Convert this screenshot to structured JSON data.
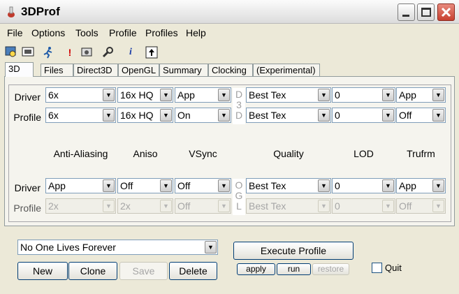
{
  "window": {
    "title": "3DProf"
  },
  "menu": [
    "File",
    "Options",
    "Tools",
    "Profile",
    "Profiles",
    "Help"
  ],
  "toolbar_icons": [
    "image-search-icon",
    "display-icon",
    "runner-icon",
    "exclamation-icon",
    "gear-icon",
    "wrench-icon",
    "info-icon",
    "upload-icon"
  ],
  "tabs": [
    "3D",
    "Files",
    "Direct3D",
    "OpenGL",
    "Summary",
    "Clocking",
    "(Experimental)"
  ],
  "d3d": {
    "vertical_letters": [
      "D",
      "3",
      "D"
    ],
    "driver_label": "Driver",
    "profile_label": "Profile",
    "driver": {
      "aa": "6x",
      "aniso": "16x HQ",
      "vsync": "App",
      "quality": "Best Tex",
      "lod": "0",
      "trufrm": "App"
    },
    "profile": {
      "aa": "6x",
      "aniso": "16x HQ",
      "vsync": "On",
      "quality": "Best Tex",
      "lod": "0",
      "trufrm": "Off"
    }
  },
  "columns": {
    "aa": "Anti-Aliasing",
    "aniso": "Aniso",
    "vsync": "VSync",
    "quality": "Quality",
    "lod": "LOD",
    "trufrm": "Trufrm"
  },
  "ogl": {
    "vertical_letters": [
      "O",
      "G",
      "L"
    ],
    "driver_label": "Driver",
    "profile_label": "Profile",
    "driver": {
      "aa": "App",
      "aniso": "Off",
      "vsync": "Off",
      "quality": "Best Tex",
      "lod": "0",
      "trufrm": "App"
    },
    "profile": {
      "aa": "2x",
      "aniso": "2x",
      "vsync": "Off",
      "quality": "Best Tex",
      "lod": "0",
      "trufrm": "Off"
    }
  },
  "profile_select": "No One Lives Forever",
  "buttons": {
    "new": "New",
    "clone": "Clone",
    "save": "Save",
    "delete": "Delete",
    "execute": "Execute Profile",
    "apply": "apply",
    "run": "run",
    "restore": "restore"
  },
  "quit_label": "Quit"
}
